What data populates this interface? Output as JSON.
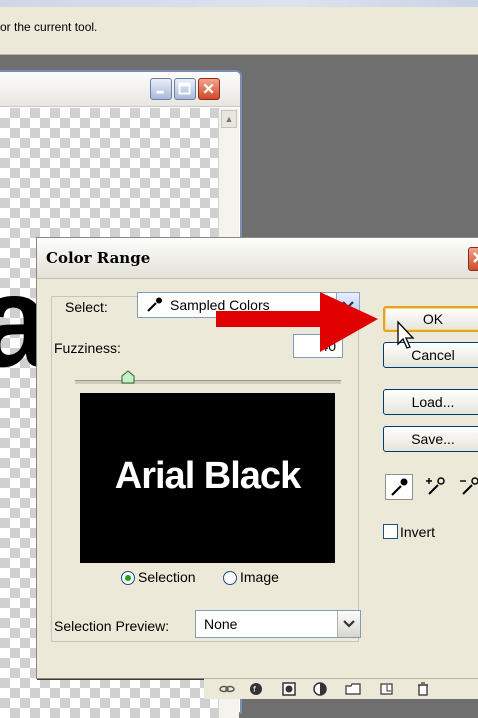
{
  "hint_bar": {
    "text": "or the current tool."
  },
  "document_window": {
    "canvas_letter": "a"
  },
  "dialog": {
    "title": "Color Range",
    "select_label": "Select:",
    "select_value": "Sampled Colors",
    "fuzziness_label": "Fuzziness:",
    "fuzziness_value": "40",
    "fuzziness_slider_fraction": 0.2,
    "preview_text": "Arial Black",
    "radio_selection": "Selection",
    "radio_image": "Image",
    "selected_radio": "Selection",
    "selection_preview_label": "Selection Preview:",
    "selection_preview_value": "None",
    "buttons": {
      "ok": "OK",
      "cancel": "Cancel",
      "load": "Load...",
      "save": "Save..."
    },
    "eyedroppers": [
      "eyedropper-icon",
      "eyedropper-plus-icon",
      "eyedropper-minus-icon"
    ],
    "invert_label": "Invert",
    "invert_checked": false
  },
  "colors": {
    "dialog_bg": "#ece9d8",
    "default_button_border": "#e5a420",
    "annotation_arrow": "#e00000",
    "workspace_bg": "#6f6f6f"
  },
  "layer_toolbar_icons": [
    "link-icon",
    "layer-style-icon",
    "add-mask-icon",
    "adjustment-layer-icon",
    "new-group-icon",
    "new-layer-icon",
    "trash-icon"
  ]
}
